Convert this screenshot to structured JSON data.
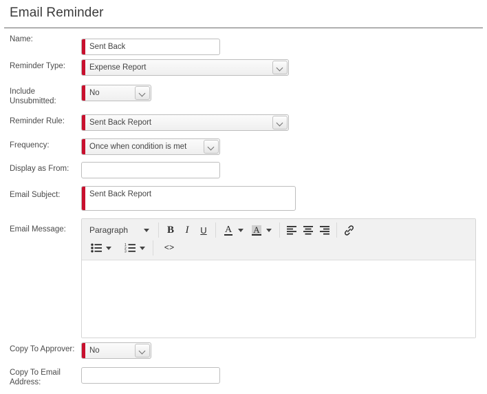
{
  "page": {
    "title": "Email Reminder"
  },
  "form": {
    "fields": [
      {
        "label": "Name:",
        "value": "Sent Back",
        "required": true,
        "type": "text"
      },
      {
        "label": "Reminder Type:",
        "value": "Expense Report",
        "required": true,
        "type": "select"
      },
      {
        "label": "Include Unsubmitted:",
        "value": "No",
        "required": true,
        "type": "select"
      },
      {
        "label": "Reminder Rule:",
        "value": "Sent Back Report",
        "required": true,
        "type": "select"
      },
      {
        "label": "Frequency:",
        "value": "Once when condition is met",
        "required": true,
        "type": "select"
      },
      {
        "label": "Display as From:",
        "value": "",
        "required": false,
        "type": "text"
      },
      {
        "label": "Email Subject:",
        "value": "Sent Back Report",
        "required": true,
        "type": "text"
      },
      {
        "label": "Email Message:",
        "value": "",
        "required": false,
        "type": "richtext"
      },
      {
        "label": "Copy To Approver:",
        "value": "No",
        "required": true,
        "type": "select"
      },
      {
        "label": "Copy To Email Address:",
        "value": "",
        "required": false,
        "type": "text"
      }
    ]
  },
  "editor": {
    "style_dropdown": {
      "label": "Paragraph",
      "icon": "chevron-down-icon"
    },
    "toolbar_row1": [
      {
        "name": "bold-button",
        "glyph": "B"
      },
      {
        "name": "italic-button",
        "glyph": "I"
      },
      {
        "name": "underline-button",
        "glyph": "U"
      },
      {
        "name": "text-color-button",
        "glyph": "A"
      },
      {
        "name": "highlight-color-button",
        "glyph": "A"
      },
      {
        "name": "align-left-button",
        "glyph": "align-left-icon"
      },
      {
        "name": "align-center-button",
        "glyph": "align-center-icon"
      },
      {
        "name": "align-right-button",
        "glyph": "align-right-icon"
      },
      {
        "name": "insert-link-button",
        "glyph": "link-icon"
      }
    ],
    "toolbar_row2": [
      {
        "name": "bullet-list-button",
        "glyph": "bullet-list-icon"
      },
      {
        "name": "numbered-list-button",
        "glyph": "numbered-list-icon"
      },
      {
        "name": "source-code-button",
        "glyph": "<>"
      }
    ],
    "body_text": ""
  },
  "colors": {
    "required_marker": "#c8102e",
    "border": "#bdbdbd",
    "toolbar_bg": "#f1f1f1",
    "text": "#444444"
  }
}
